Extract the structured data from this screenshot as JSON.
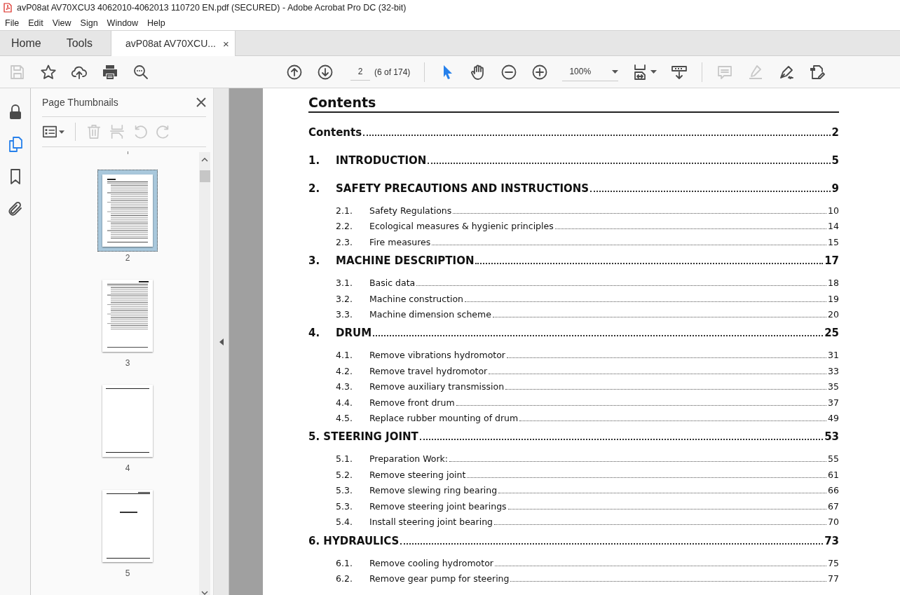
{
  "window": {
    "title": "avP08at AV70XCU3 4062010-4062013 110720 EN.pdf (SECURED) - Adobe Acrobat Pro DC (32-bit)"
  },
  "menu": [
    "File",
    "Edit",
    "View",
    "Sign",
    "Window",
    "Help"
  ],
  "tabs": [
    {
      "label": "Home",
      "selected": false,
      "kind": "nav"
    },
    {
      "label": "Tools",
      "selected": false,
      "kind": "nav"
    },
    {
      "label": "avP08at AV70XCU...",
      "selected": true,
      "kind": "document",
      "close": "×"
    }
  ],
  "toolbar": {
    "left_tools": [
      {
        "kind": "save",
        "disabled": true
      },
      {
        "kind": "star",
        "disabled": false
      },
      {
        "kind": "upload",
        "disabled": false
      },
      {
        "kind": "print",
        "disabled": false
      },
      {
        "kind": "find",
        "disabled": false
      }
    ],
    "page_field": {
      "value": "2"
    },
    "page_count": "(6 of 174)",
    "nav_tools": [
      {
        "kind": "prev",
        "disabled": false
      },
      {
        "kind": "next",
        "disabled": false
      }
    ],
    "view_tools": [
      {
        "kind": "pointer",
        "selected": true
      },
      {
        "kind": "hand",
        "selected": false
      },
      {
        "kind": "zoom-out",
        "selected": false
      },
      {
        "kind": "zoom-in",
        "selected": false
      }
    ],
    "zoom": {
      "value": "100%"
    },
    "right_tools": [
      {
        "kind": "fit",
        "disabled": false
      },
      {
        "kind": "scroll",
        "disabled": false
      },
      {
        "kind": "comment",
        "disabled": true
      },
      {
        "kind": "highlight",
        "disabled": true
      },
      {
        "kind": "sign",
        "disabled": false
      },
      {
        "kind": "edit",
        "disabled": false
      }
    ]
  },
  "rail": [
    {
      "kind": "lock",
      "selected": false
    },
    {
      "kind": "pages",
      "selected": true
    },
    {
      "kind": "bookmark",
      "selected": false
    },
    {
      "kind": "attachment",
      "selected": false
    }
  ],
  "panel": {
    "title": "Page Thumbnails",
    "tools": [
      {
        "kind": "options",
        "disabled": false
      },
      {
        "kind": "delete",
        "disabled": true
      },
      {
        "kind": "insert",
        "disabled": true
      },
      {
        "kind": "undo",
        "disabled": true
      },
      {
        "kind": "redo",
        "disabled": true
      }
    ],
    "thumbnails": [
      {
        "label": "2",
        "kind": "toc",
        "selected": true
      },
      {
        "label": "3",
        "kind": "toc-cont",
        "selected": false
      },
      {
        "label": "4",
        "kind": "blank",
        "selected": false
      },
      {
        "label": "5",
        "kind": "title",
        "selected": false
      }
    ]
  },
  "document": {
    "heading": "Contents",
    "entries": [
      {
        "kind": "top",
        "title": "Contents",
        "page": "2"
      },
      {
        "kind": "chapter",
        "number": "1.",
        "title": "INTRODUCTION",
        "page": "5"
      },
      {
        "kind": "chapter",
        "number": "2.",
        "title": "SAFETY PRECAUTIONS AND INSTRUCTIONS",
        "page": "9",
        "children": [
          {
            "number": "2.1.",
            "title": "Safety Regulations",
            "page": "10"
          },
          {
            "number": "2.2.",
            "title": "Ecological measures & hygienic principles",
            "page": "14"
          },
          {
            "number": "2.3.",
            "title": "Fire measures",
            "page": "15"
          }
        ]
      },
      {
        "kind": "chapter",
        "number": "3.",
        "title": "MACHINE DESCRIPTION",
        "page": "17",
        "children": [
          {
            "number": "3.1.",
            "title": "Basic data",
            "page": "18"
          },
          {
            "number": "3.2.",
            "title": "Machine construction",
            "page": "19"
          },
          {
            "number": "3.3.",
            "title": "Machine dimension scheme",
            "page": "20"
          }
        ]
      },
      {
        "kind": "chapter",
        "number": "4.",
        "title": "DRUM",
        "page": "25",
        "children": [
          {
            "number": "4.1.",
            "title": "Remove vibrations hydromotor",
            "page": "31"
          },
          {
            "number": "4.2.",
            "title": "Remove travel hydromotor",
            "page": "33"
          },
          {
            "number": "4.3.",
            "title": "Remove auxiliary transmission",
            "page": "35"
          },
          {
            "number": "4.4.",
            "title": "Remove front drum",
            "page": "37"
          },
          {
            "number": "4.5.",
            "title": "Replace rubber mounting of drum",
            "page": "49"
          }
        ]
      },
      {
        "kind": "chapter-inline",
        "title": "5. STEERING JOINT",
        "page": "53",
        "children": [
          {
            "number": "5.1.",
            "title": "Preparation Work:",
            "page": "55"
          },
          {
            "number": "5.2.",
            "title": "Remove steering joint",
            "page": "61"
          },
          {
            "number": "5.3.",
            "title": "Remove slewing ring bearing",
            "page": "66"
          },
          {
            "number": "5.3.",
            "title": "Remove steering joint bearings",
            "page": "67"
          },
          {
            "number": "5.4.",
            "title": "Install steering joint bearing",
            "page": "70"
          }
        ]
      },
      {
        "kind": "chapter-inline",
        "title": "6. HYDRAULICS",
        "page": "73",
        "children": [
          {
            "number": "6.1.",
            "title": "Remove cooling hydromotor",
            "page": "75"
          },
          {
            "number": "6.2.",
            "title": "Remove gear pump for steering",
            "page": "77"
          }
        ]
      }
    ]
  }
}
